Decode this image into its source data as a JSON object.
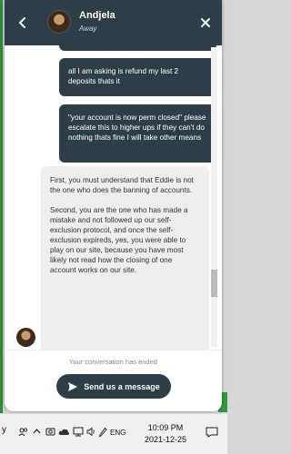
{
  "chat": {
    "agent_name": "Andjela",
    "agent_status": "Away",
    "messages": [
      {
        "from": "user",
        "text": "all I am asking is refund my last 2 deposits thats it"
      },
      {
        "from": "user",
        "text": "\"your account is now perm closed\" please escalate this to higher ups if they can't do nothing thats fine I will take other means"
      },
      {
        "from": "agent",
        "paragraphs": [
          "First, you must understand that Eddie is not the one who does the banning of accounts.",
          "Second, you are the one who has made a mistake and not followed up our self-exclusion protocol, and once the self-exclusion expireds, yes, you were able to play on our site, because you have most likely not read how the closing of one account works on our site."
        ]
      }
    ],
    "ended_text": "Your conversation has ended",
    "send_button_label": "Send us a message"
  },
  "taskbar": {
    "partial_label": "y",
    "language": "ENG",
    "time": "10:09 PM",
    "date": "2021-12-25"
  },
  "colors": {
    "header": "#2e3e48",
    "user_bubble": "#2e3e48",
    "agent_bubble": "#eeeeee"
  }
}
